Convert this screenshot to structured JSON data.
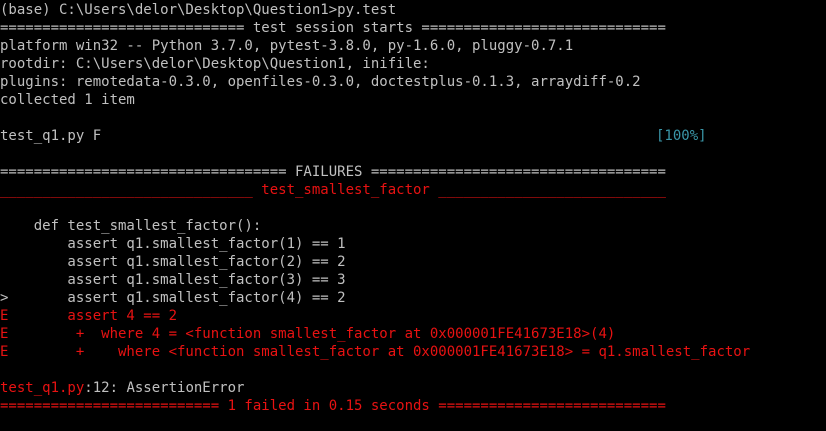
{
  "terminal": {
    "lines": [
      {
        "text": "(base) C:\\Users\\delor\\Desktop\\Question1>py.test",
        "color": "gray"
      },
      {
        "text": "============================= test session starts =============================",
        "color": "gray"
      },
      {
        "text": "platform win32 -- Python 3.7.0, pytest-3.8.0, py-1.6.0, pluggy-0.7.1",
        "color": "gray"
      },
      {
        "text": "rootdir: C:\\Users\\delor\\Desktop\\Question1, inifile:",
        "color": "gray"
      },
      {
        "text": "plugins: remotedata-0.3.0, openfiles-0.3.0, doctestplus-0.1.3, arraydiff-0.2",
        "color": "gray"
      },
      {
        "text": "collected 1 item",
        "color": "gray"
      },
      {
        "text": "",
        "color": "gray"
      },
      {
        "text": "test_q1.py F",
        "color": "gray",
        "suffix": "[100%]",
        "suffix_color": "teal"
      },
      {
        "text": "",
        "color": "gray"
      },
      {
        "text": "================================== FAILURES ===================================",
        "color": "gray"
      },
      {
        "text": "______________________________ test_smallest_factor ___________________________",
        "color": "red"
      },
      {
        "text": "",
        "color": "gray"
      },
      {
        "text": "    def test_smallest_factor():",
        "color": "gray"
      },
      {
        "text": "        assert q1.smallest_factor(1) == 1",
        "color": "gray"
      },
      {
        "text": "        assert q1.smallest_factor(2) == 2",
        "color": "gray"
      },
      {
        "text": "        assert q1.smallest_factor(3) == 3",
        "color": "gray"
      },
      {
        "text": ">       assert q1.smallest_factor(4) == 2",
        "color": "gray"
      },
      {
        "text": "E       assert 4 == 2",
        "color": "red"
      },
      {
        "text": "E        +  where 4 = <function smallest_factor at 0x000001FE41673E18>(4)",
        "color": "red"
      },
      {
        "text": "E        +    where <function smallest_factor at 0x000001FE41673E18> = q1.smallest_factor",
        "color": "red"
      },
      {
        "text": "",
        "color": "gray"
      },
      {
        "text": "test_q1.py",
        "color": "red",
        "suffix": ":12: AssertionError",
        "suffix_color": "gray",
        "inline": true
      },
      {
        "text": "========================== 1 failed in 0.15 seconds ===========================",
        "color": "red"
      }
    ]
  },
  "colors": {
    "background": "#000000",
    "gray": "#c0c0c0",
    "red": "#e81212",
    "teal": "#3a96a8"
  }
}
